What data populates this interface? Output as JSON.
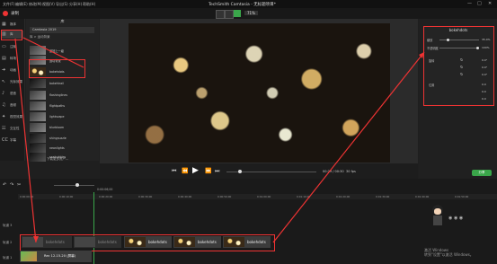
{
  "app": {
    "title": "TechSmith Camtasia - 无标题项目*",
    "menu": [
      "文件(F)",
      "编辑(E)",
      "修改(M)",
      "视图(V)",
      "导出(S)",
      "分享(H)",
      "帮助(H)"
    ],
    "record_label": "录制",
    "zoom": "71%"
  },
  "sidebar": {
    "items": [
      {
        "label": "媒体",
        "icon": "media-icon"
      },
      {
        "label": "库",
        "icon": "library-icon"
      },
      {
        "label": "注释",
        "icon": "annotation-icon"
      },
      {
        "label": "转场",
        "icon": "transition-icon"
      },
      {
        "label": "动画",
        "icon": "animation-icon"
      },
      {
        "label": "光标效果",
        "icon": "cursor-icon"
      },
      {
        "label": "语音",
        "icon": "voice-icon"
      },
      {
        "label": "音频",
        "icon": "audio-icon"
      },
      {
        "label": "视觉效果",
        "icon": "visual-effects-icon"
      },
      {
        "label": "交互性",
        "icon": "interactivity-icon"
      },
      {
        "label": "字幕",
        "icon": "captions-icon"
      }
    ]
  },
  "library": {
    "header": "库",
    "dropdown": "Camtasia 2019",
    "breadcrumb": "库 > 运动背景",
    "items": [
      {
        "label": "返回上一级",
        "thumb": "light"
      },
      {
        "label": "运动背景",
        "thumb": "light"
      },
      {
        "label": "bokehdots",
        "thumb": "bokeh"
      },
      {
        "label": "bokehtrail",
        "thumb": "dark"
      },
      {
        "label": "flashinglines",
        "thumb": "light"
      },
      {
        "label": "flightpaths",
        "thumb": "light"
      },
      {
        "label": "lightscape",
        "thumb": "light"
      },
      {
        "label": "blurbloom",
        "thumb": "light"
      },
      {
        "label": "shinypuzzle",
        "thumb": "dark"
      },
      {
        "label": "neonlights",
        "thumb": "dark"
      },
      {
        "label": "seabubbles",
        "thumb": "dark"
      }
    ],
    "more": "下载更多资产..."
  },
  "properties": {
    "title": "bokehdots",
    "rows": [
      {
        "label": "缩放",
        "value": "35.4%"
      },
      {
        "label": "不透明度",
        "value": "100%"
      },
      {
        "label": "旋转",
        "value": "0.0°"
      },
      {
        "label": "",
        "value": "0.0°"
      },
      {
        "label": "",
        "value": "0.0°"
      },
      {
        "label": "位置",
        "value": "0.0"
      },
      {
        "label": "",
        "value": "0.0"
      },
      {
        "label": "",
        "value": "0.0"
      }
    ]
  },
  "playback": {
    "time": "00:29 / 00:30",
    "fps": "30 fps",
    "export_label": "分享"
  },
  "timeline": {
    "playhead": "0:00:06;00",
    "ticks": [
      "0:00:00;00",
      "0:00:10;00",
      "0:00:20;00",
      "0:00:30;00",
      "0:00:40;00",
      "0:00:50;00",
      "0:01:00;00",
      "0:01:10;00",
      "0:01:20;00",
      "0:01:30;00",
      "0:01:40;00",
      "0:01:50;00"
    ],
    "tracks": [
      {
        "label": "轨道 3"
      },
      {
        "label": "轨道 2"
      },
      {
        "label": "轨道 1"
      }
    ],
    "clips": [
      {
        "label": "bokehdots"
      },
      {
        "label": "bokehdots"
      },
      {
        "label": "bokehdots"
      },
      {
        "label": "bokehdots"
      },
      {
        "label": "bokehdots"
      }
    ],
    "bottom_clip": "Rec 12-15-20 (屏幕)"
  },
  "os": {
    "activate_title": "激活 Windows",
    "activate_sub": "转到\"设置\"以激活 Windows。"
  }
}
